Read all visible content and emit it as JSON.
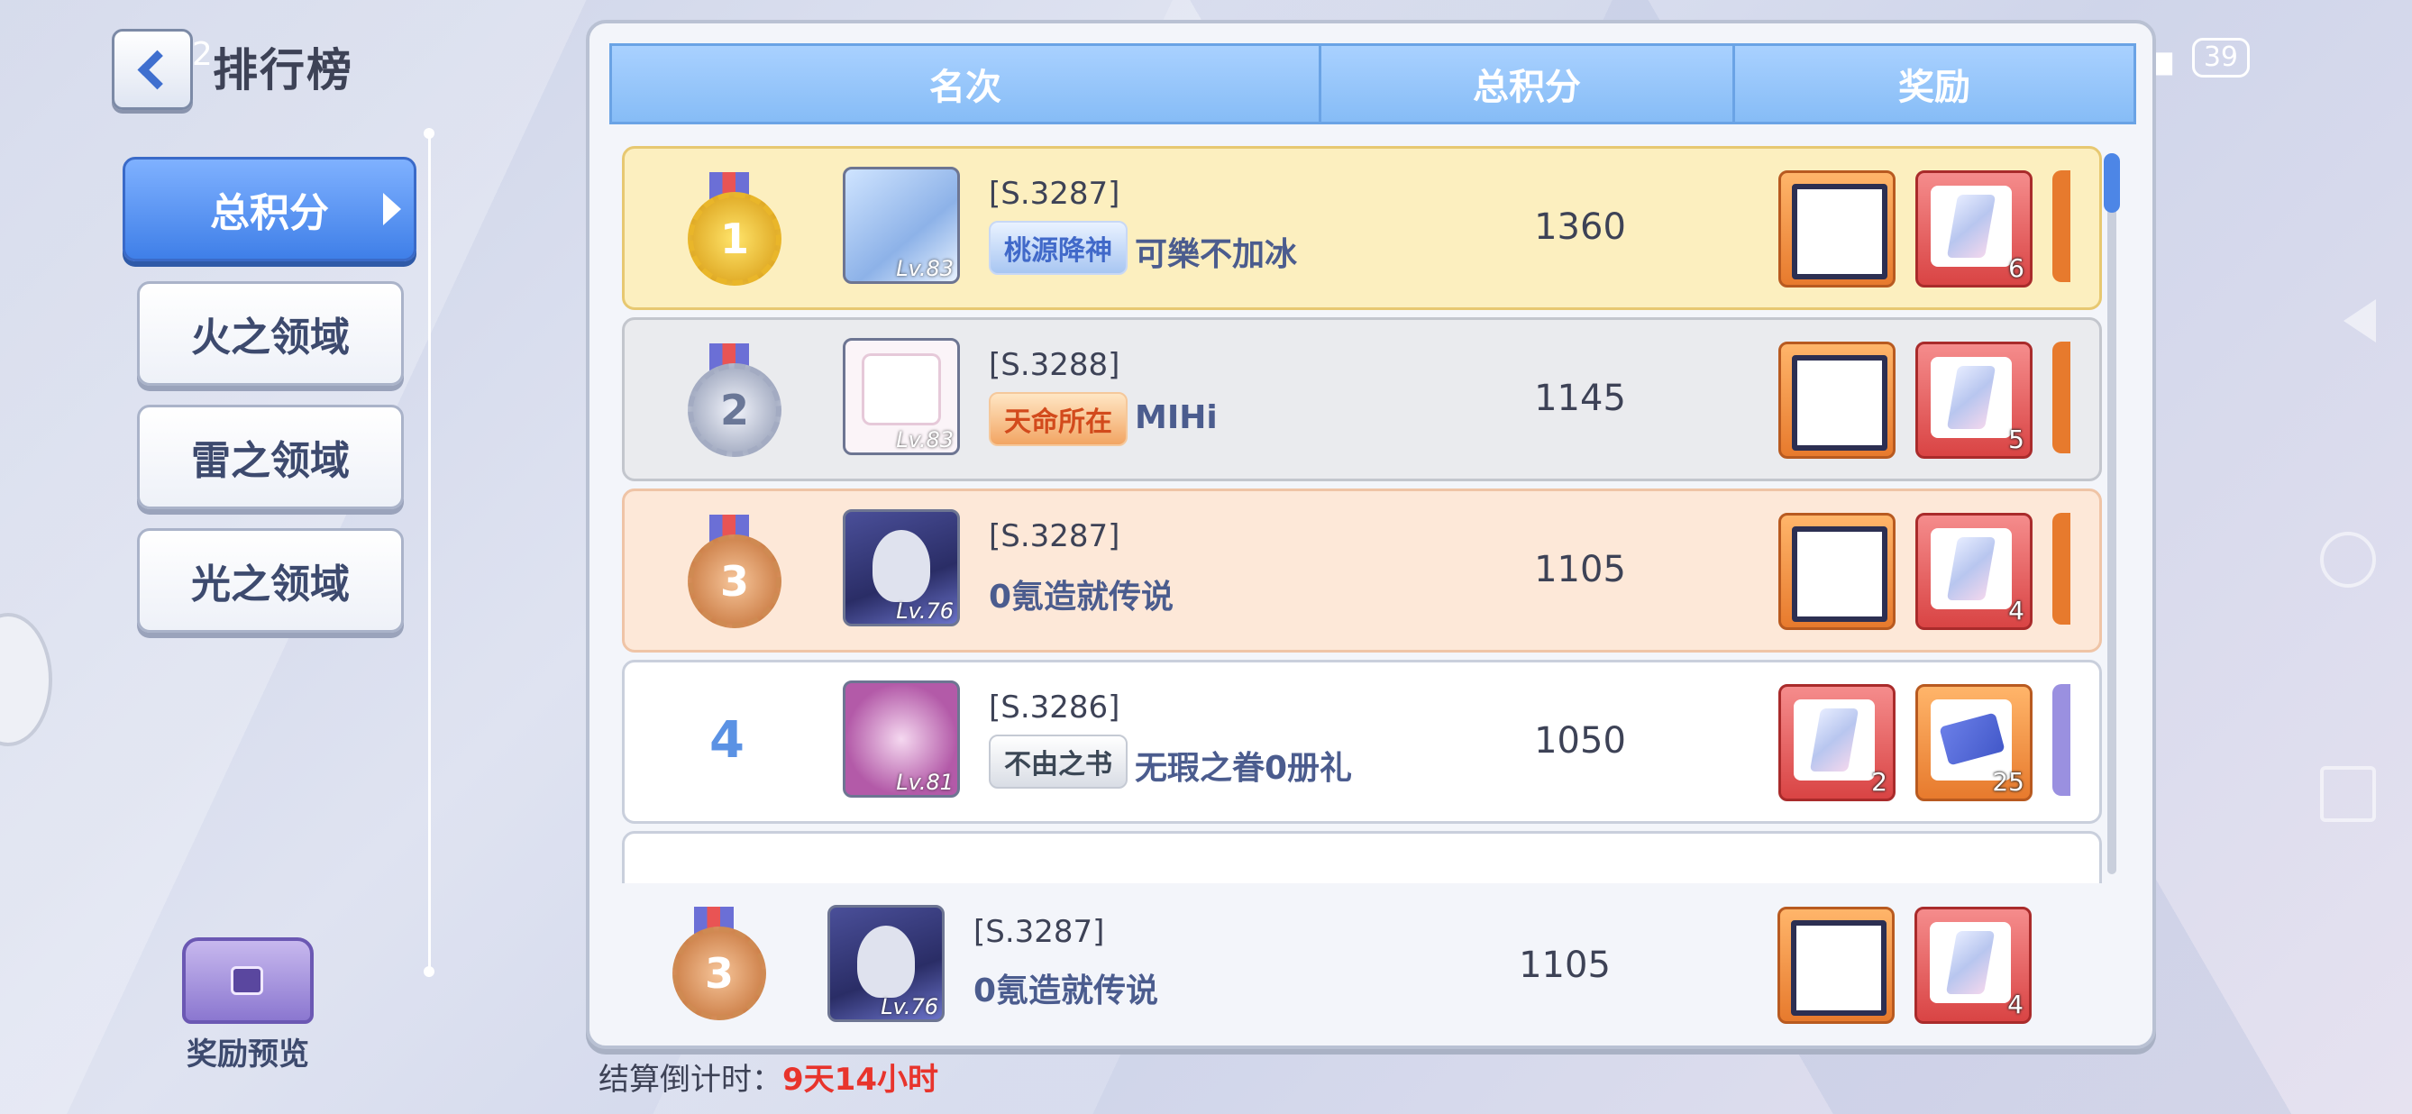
{
  "status_bar": {
    "time": "12",
    "battery": "39"
  },
  "title": "排行榜",
  "tabs": [
    {
      "label": "总积分",
      "active": true
    },
    {
      "label": "火之领域",
      "active": false
    },
    {
      "label": "雷之领域",
      "active": false
    },
    {
      "label": "光之领域",
      "active": false
    }
  ],
  "reward_preview_label": "奖励预览",
  "table_headers": {
    "rank": "名次",
    "score": "总积分",
    "reward": "奖励"
  },
  "rows": [
    {
      "rank": "1",
      "server": "[S.3287]",
      "title_badge": "桃源降神",
      "name": "可樂不加冰",
      "level": "Lv.83",
      "score": "1360",
      "rewards": [
        "frame",
        "crystal 6"
      ]
    },
    {
      "rank": "2",
      "server": "[S.3288]",
      "title_badge": "天命所在",
      "name": "MIHi",
      "level": "Lv.83",
      "score": "1145",
      "rewards": [
        "frame",
        "crystal 5"
      ]
    },
    {
      "rank": "3",
      "server": "[S.3287]",
      "title_badge": "",
      "name": "0氪造就传说",
      "level": "Lv.76",
      "score": "1105",
      "rewards": [
        "frame",
        "crystal 4"
      ]
    },
    {
      "rank": "4",
      "server": "[S.3286]",
      "title_badge": "不由之书",
      "name": "无瑕之眷0册礼",
      "level": "Lv.81",
      "score": "1050",
      "rewards": [
        "crystal 2",
        "ticket 25"
      ]
    }
  ],
  "reward_counts": {
    "r1": "6",
    "r2": "5",
    "r3": "4",
    "r4a": "2",
    "r4b": "25",
    "me": "4"
  },
  "my_rank": {
    "rank": "3",
    "server": "[S.3287]",
    "name": "0氪造就传说",
    "level": "Lv.76",
    "score": "1105"
  },
  "countdown": {
    "label": "结算倒计时：",
    "value": "9天14小时"
  },
  "colors": {
    "accent": "#4d86e6",
    "countdown": "#e8342c",
    "gold_row": "#fcefbf",
    "bronze_row": "#fde8d8"
  }
}
